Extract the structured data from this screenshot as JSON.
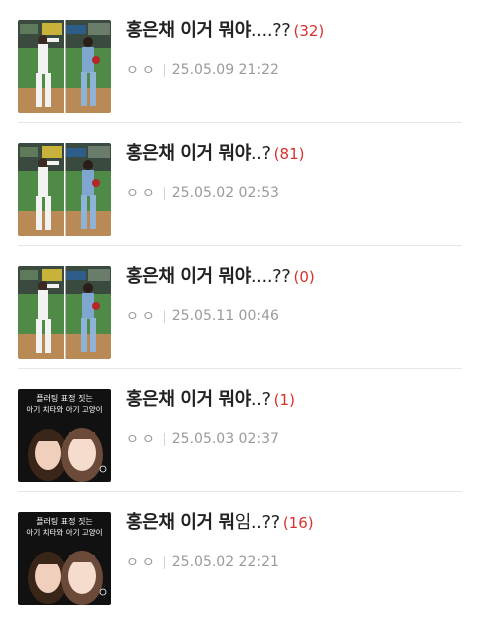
{
  "posts": [
    {
      "title": "홍은채 이거 뭐야",
      "tail": "....??",
      "count": "(32)",
      "author": "ㅇㅇ",
      "date": "25.05.09 21:22",
      "thumb": "baseball"
    },
    {
      "title": "홍은채 이거 뭐야",
      "tail": "..?",
      "count": "(81)",
      "author": "ㅇㅇ",
      "date": "25.05.02 02:53",
      "thumb": "baseball"
    },
    {
      "title": "홍은채 이거 뭐야",
      "tail": "....??",
      "count": "(0)",
      "author": "ㅇㅇ",
      "date": "25.05.11 00:46",
      "thumb": "baseball"
    },
    {
      "title": "홍은채 이거 뭐야",
      "tail": "..?",
      "count": "(1)",
      "author": "ㅇㅇ",
      "date": "25.05.03 02:37",
      "thumb": "portrait",
      "caption1": "플러팅 표정 짓는",
      "caption2": "아기 치타와 아기 고양이"
    },
    {
      "title": "홍은채 이거 뭐",
      "tail": "임..??",
      "count": "(16)",
      "author": "ㅇㅇ",
      "date": "25.05.02 22:21",
      "thumb": "portrait",
      "caption1": "플러팅 표정 짓는",
      "caption2": "아기 치타와 아기 고양이"
    }
  ]
}
